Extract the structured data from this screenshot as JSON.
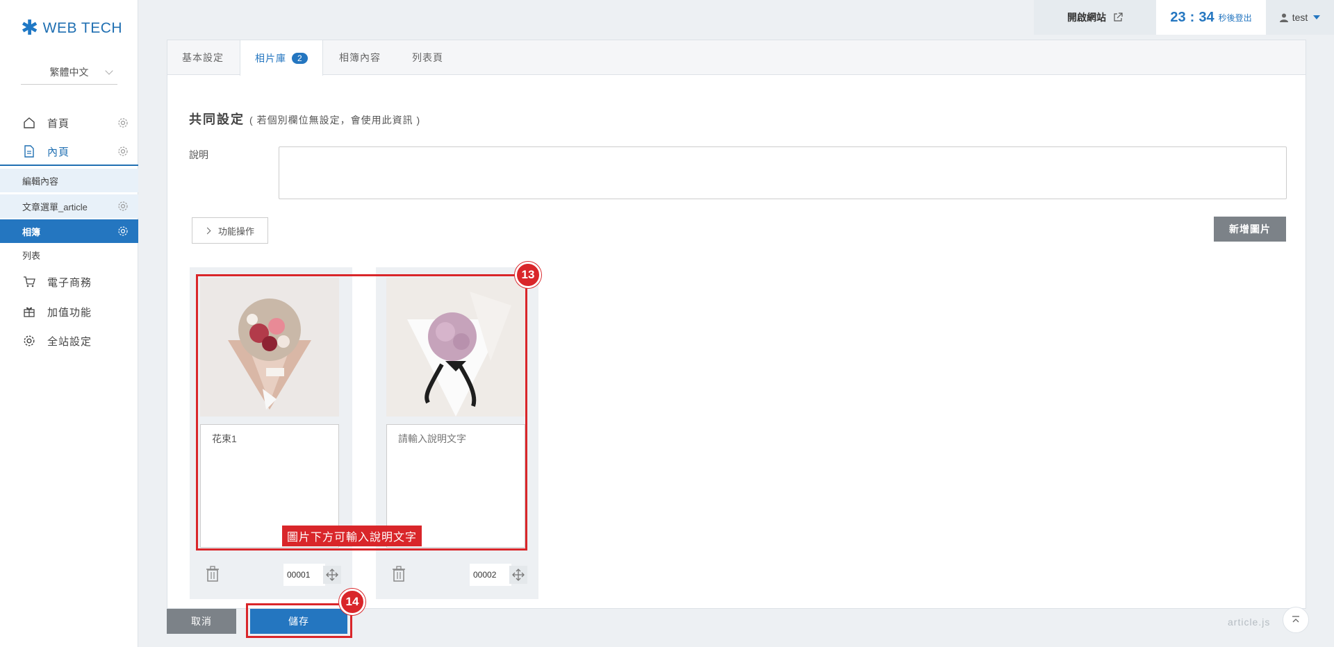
{
  "brand": {
    "logo_text": "WEB TECH"
  },
  "language": {
    "selected": "繁體中文"
  },
  "sidebar": {
    "items": [
      {
        "label": "首頁"
      },
      {
        "label": "內頁"
      }
    ],
    "sub_items": [
      {
        "label": "編輯內容"
      },
      {
        "label": "文章選單_article"
      },
      {
        "label": "相簿"
      },
      {
        "label": "列表"
      }
    ],
    "more_items": [
      {
        "label": "電子商務"
      },
      {
        "label": "加值功能"
      },
      {
        "label": "全站設定"
      }
    ]
  },
  "topbar": {
    "open_site": "開啟網站",
    "timer_minutes": "23",
    "timer_colon": ":",
    "timer_seconds": "34",
    "timer_text": "秒後登出",
    "user": "test"
  },
  "tabs": [
    {
      "label": "基本設定"
    },
    {
      "label": "相片庫",
      "badge": "2"
    },
    {
      "label": "相簿內容"
    },
    {
      "label": "列表頁"
    }
  ],
  "common_settings": {
    "title": "共同設定",
    "subtitle": "( 若個別欄位無設定，會使用此資訊 )",
    "desc_label": "說明"
  },
  "buttons": {
    "func_ops": "功能操作",
    "add_image": "新增圖片",
    "cancel": "取消",
    "save": "儲存"
  },
  "photos": [
    {
      "caption": "花束1",
      "order": "00001"
    },
    {
      "caption_placeholder": "請輸入說明文字",
      "order": "00002"
    }
  ],
  "annotations": {
    "step13": "13",
    "step13_label": "圖片下方可輸入說明文字",
    "step14": "14"
  },
  "footer": {
    "file": "article.js"
  },
  "colors": {
    "accent": "#2476c0",
    "annotation": "#d9262a",
    "gray_button": "#7c8288"
  }
}
